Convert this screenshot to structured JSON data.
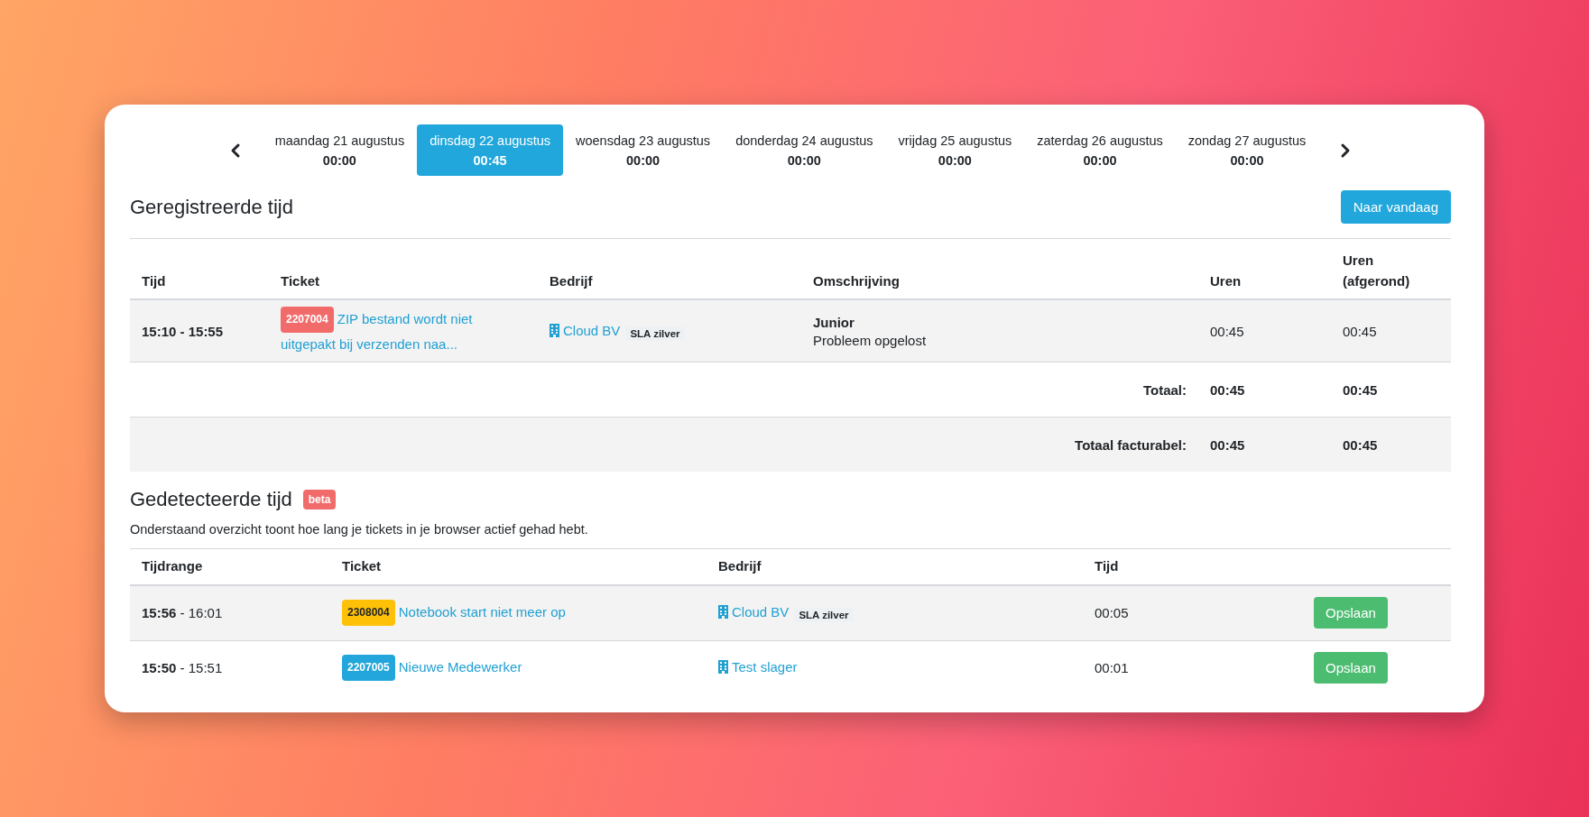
{
  "days": [
    {
      "label": "maandag 21 augustus",
      "total": "00:00",
      "selected": false
    },
    {
      "label": "dinsdag 22 augustus",
      "total": "00:45",
      "selected": true
    },
    {
      "label": "woensdag 23 augustus",
      "total": "00:00",
      "selected": false
    },
    {
      "label": "donderdag 24 augustus",
      "total": "00:00",
      "selected": false
    },
    {
      "label": "vrijdag 25 augustus",
      "total": "00:00",
      "selected": false
    },
    {
      "label": "zaterdag 26 augustus",
      "total": "00:00",
      "selected": false
    },
    {
      "label": "zondag 27 augustus",
      "total": "00:00",
      "selected": false
    }
  ],
  "registered": {
    "title": "Geregistreerde tijd",
    "today_button": "Naar vandaag",
    "columns": [
      "Tijd",
      "Ticket",
      "Bedrijf",
      "Omschrijving",
      "Uren",
      "Uren (afgerond)"
    ],
    "rows": [
      {
        "time": "15:10 - 15:55",
        "ticket": {
          "number": "2207004",
          "color": "#f26b6b",
          "title": "ZIP bestand wordt niet uitgepakt bij verzenden naa..."
        },
        "company": {
          "name": "Cloud BV",
          "sla": "SLA zilver"
        },
        "description": {
          "role": "Junior",
          "text": "Probleem opgelost"
        },
        "hours": "00:45",
        "rounded": "00:45"
      }
    ],
    "totals": [
      {
        "label": "Totaal:",
        "hours": "00:45",
        "rounded": "00:45"
      },
      {
        "label": "Totaal facturabel:",
        "hours": "00:45",
        "rounded": "00:45"
      }
    ]
  },
  "detected": {
    "title": "Gedetecteerde tijd",
    "badge": "beta",
    "description": "Onderstaand overzicht toont hoe lang je tickets in je browser actief gehad hebt.",
    "columns": [
      "Tijdrange",
      "Ticket",
      "Bedrijf",
      "Tijd"
    ],
    "rows": [
      {
        "start": "15:56",
        "separator": "-",
        "end": "16:01",
        "ticket": {
          "number": "2308004",
          "color": "#ffc107",
          "title": "Notebook start niet meer op"
        },
        "company": {
          "name": "Cloud BV",
          "sla": "SLA zilver"
        },
        "time": "00:05",
        "action": "Opslaan"
      },
      {
        "start": "15:50",
        "separator": "-",
        "end": "15:51",
        "ticket": {
          "number": "2207005",
          "color": "#22a6db",
          "title": "Nieuwe Medewerker"
        },
        "company": {
          "name": "Test slager"
        },
        "time": "00:01",
        "action": "Opslaan"
      }
    ]
  }
}
